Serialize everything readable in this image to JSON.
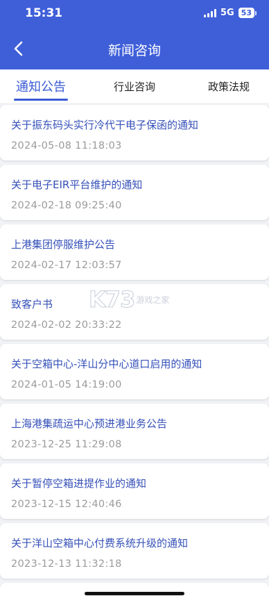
{
  "status_bar": {
    "time": "15:31",
    "network": "5G",
    "battery": "53"
  },
  "nav": {
    "title": "新闻咨询"
  },
  "tabs": [
    {
      "label": "通知公告",
      "active": true
    },
    {
      "label": "行业咨询",
      "active": false
    },
    {
      "label": "政策法规",
      "active": false
    }
  ],
  "items": [
    {
      "title": "关于振东码头实行冷代干电子保函的通知",
      "time": "2024-05-08 11:18:03"
    },
    {
      "title": "关于电子EIR平台维护的通知",
      "time": "2024-02-18 09:25:40"
    },
    {
      "title": "上港集团停服维护公告",
      "time": "2024-02-17 12:03:57"
    },
    {
      "title": "致客户书",
      "time": "2024-02-02 20:33:22"
    },
    {
      "title": "关于空箱中心-洋山分中心道口启用的通知",
      "time": "2024-01-05 14:19:00"
    },
    {
      "title": "上海港集疏运中心预进港业务公告",
      "time": "2023-12-25 11:29:08"
    },
    {
      "title": "关于暂停空箱进提作业的通知",
      "time": "2023-12-15 12:40:46"
    },
    {
      "title": "关于洋山空箱中心付费系统升级的通知",
      "time": "2023-12-13 11:32:18"
    }
  ],
  "watermark": {
    "logo": "K73",
    "text": "游戏之家"
  },
  "colors": {
    "header": "#3f5fd9",
    "accent": "#3a5bd4",
    "title_text": "#3550b8",
    "time_text": "#9a9a9a"
  }
}
